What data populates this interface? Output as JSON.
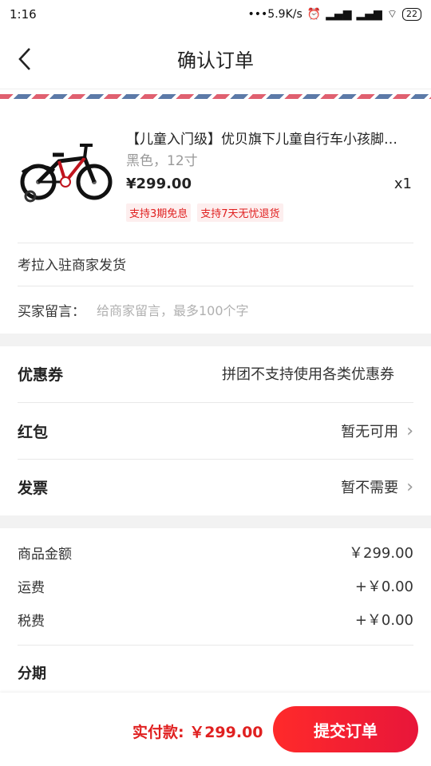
{
  "status_bar": {
    "time": "1:16",
    "network_speed": "•••5.9K/s",
    "battery": "22"
  },
  "nav": {
    "title": "确认订单"
  },
  "product": {
    "title": "【儿童入门级】优贝旗下儿童自行车小孩脚…",
    "spec": "黑色，12寸",
    "price": "¥299.00",
    "quantity": "x1",
    "tags": [
      "支持3期免息",
      "支持7天无忧退货"
    ]
  },
  "shipping": {
    "note": "考拉入驻商家发货"
  },
  "message": {
    "label": "买家留言：",
    "placeholder": "给商家留言，最多100个字"
  },
  "coupon": {
    "label": "优惠券",
    "value": "拼团不支持使用各类优惠券"
  },
  "red_packet": {
    "label": "红包",
    "value": "暂无可用"
  },
  "invoice": {
    "label": "发票",
    "value": "暂不需要"
  },
  "summary": {
    "goods_label": "商品金额",
    "goods_value": "￥299.00",
    "shipping_label": "运费",
    "shipping_value": "+￥0.00",
    "tax_label": "税费",
    "tax_value": "+￥0.00"
  },
  "installment": {
    "label": "分期"
  },
  "footer": {
    "total": "实付款: ￥299.00",
    "submit_label": "提交订单"
  },
  "colors": {
    "accent": "#e02020",
    "stripe_red": "#e06070",
    "stripe_blue": "#5c7aa8"
  },
  "icons": {
    "back": "chevron-left-icon",
    "chevron": "chevron-right-icon"
  }
}
